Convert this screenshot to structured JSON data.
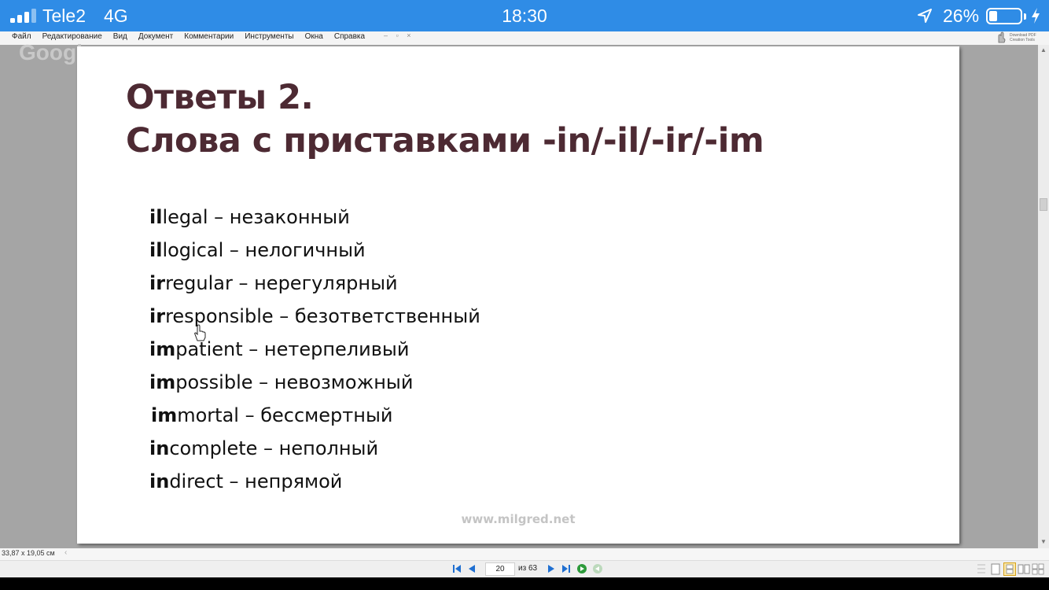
{
  "status_bar": {
    "carrier": "Tele2",
    "network": "4G",
    "time": "18:30",
    "battery_percent": "26%",
    "battery_level": 0.26,
    "icons": [
      "signal-icon",
      "location-arrow-icon",
      "battery-icon",
      "charging-bolt-icon"
    ]
  },
  "menu": {
    "items": [
      "Файл",
      "Редактирование",
      "Вид",
      "Документ",
      "Комментарии",
      "Инструменты",
      "Окна",
      "Справка"
    ],
    "extra": "– ▫ ×"
  },
  "brand": {
    "text_line1": "Download PDF",
    "text_line2": "Creation Tools"
  },
  "background_ghost": "Google",
  "page": {
    "title_line1": "Ответы 2.",
    "title_line2": "Слова с приставками -in/-il/-ir/-im",
    "words": [
      {
        "prefix": "il",
        "rest": "legal – незаконный"
      },
      {
        "prefix": "il",
        "rest": "logical – нелогичный"
      },
      {
        "prefix": "ir",
        "rest": "regular – нерегулярный"
      },
      {
        "prefix": "ir",
        "rest": "responsible – безответственный"
      },
      {
        "prefix": "im",
        "rest": "patient – нетерпеливый"
      },
      {
        "prefix": "im",
        "rest": "possible – невозможный"
      },
      {
        "prefix": "im",
        "rest": "mortal – бессмертный"
      },
      {
        "prefix": "in",
        "rest": "complete – неполный"
      },
      {
        "prefix": "in",
        "rest": "direct – непрямой"
      }
    ],
    "website": "www.milgred.net"
  },
  "status_line": {
    "page_size": "33,87 x 19,05 см",
    "arrow": "‹"
  },
  "navigation": {
    "current_page": "20",
    "total_label": "из 63",
    "icons": [
      "first-page-icon",
      "prev-page-icon",
      "next-page-icon",
      "last-page-icon",
      "go-forward-icon",
      "go-back-icon"
    ]
  },
  "colors": {
    "status_bar_bg": "#2f8ce6",
    "title_color": "#4d2a33",
    "nav_blue": "#1f6fd1",
    "nav_green": "#2c9a3a"
  }
}
